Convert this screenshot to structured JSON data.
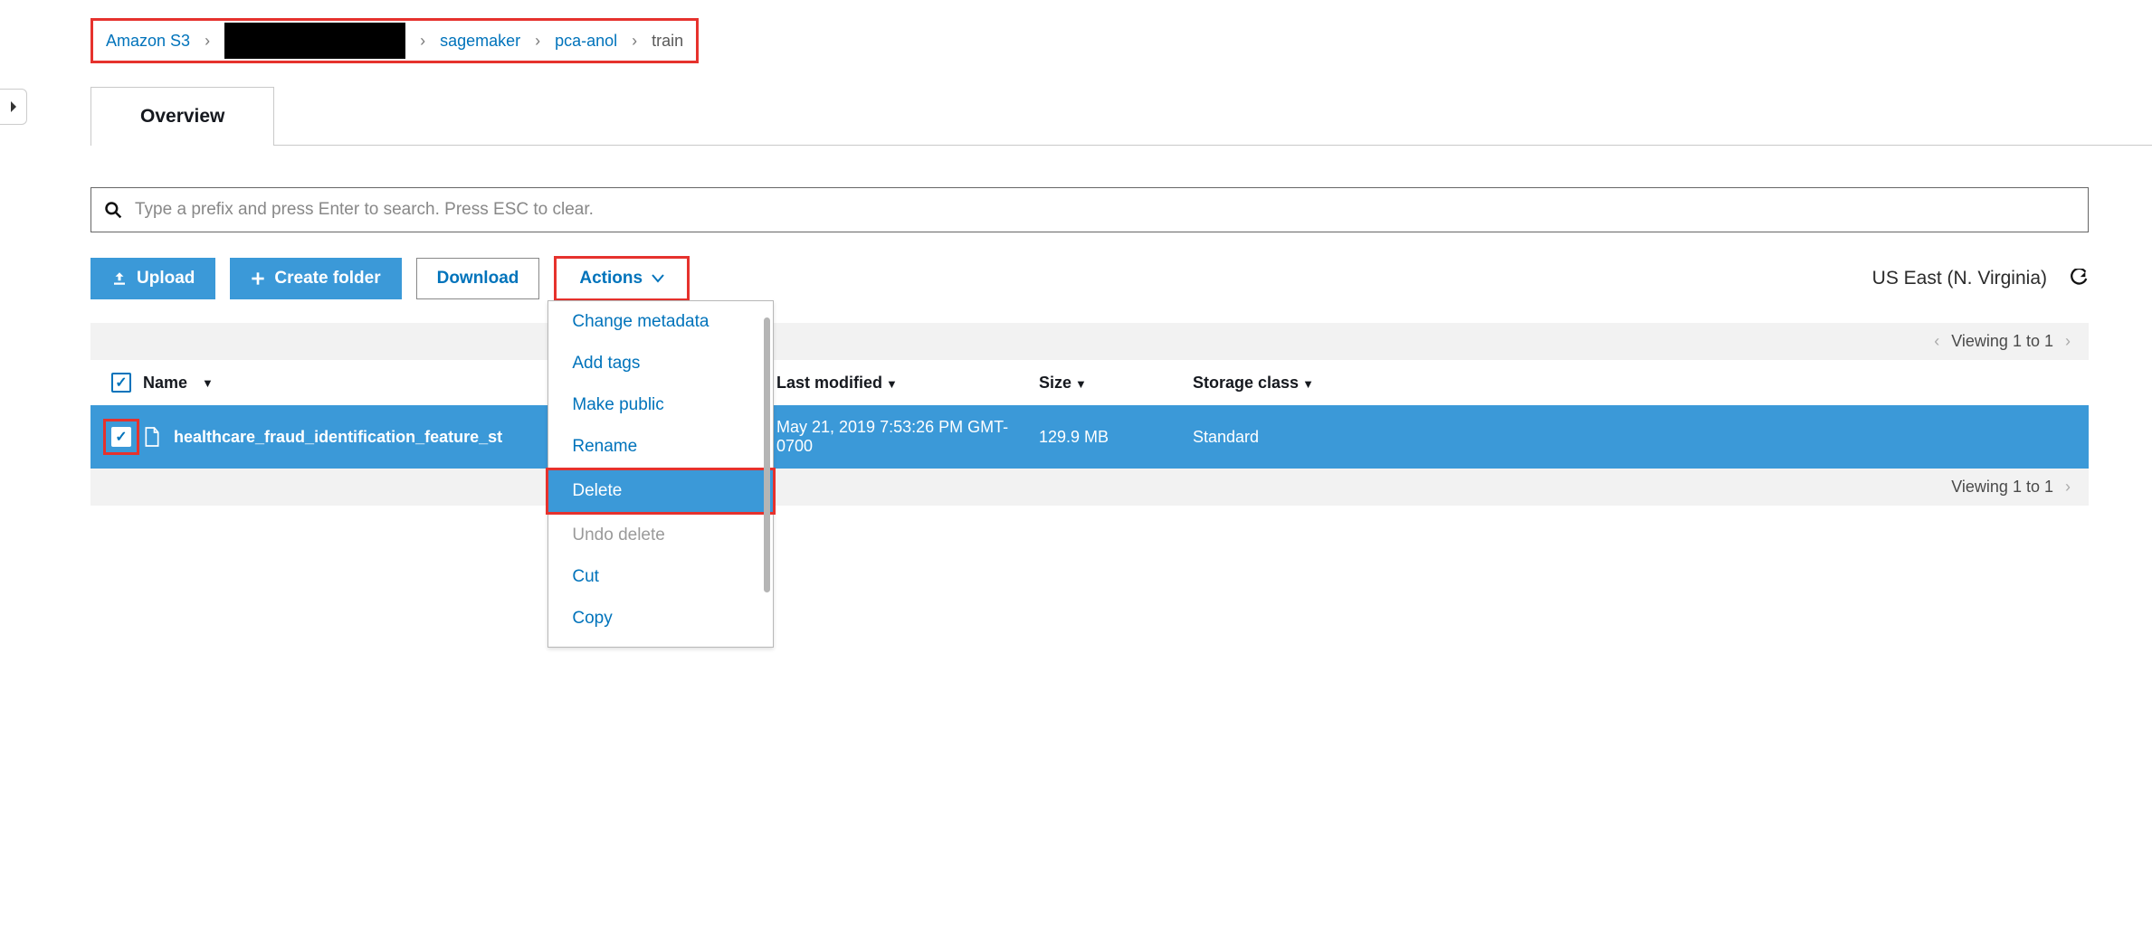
{
  "breadcrumb": {
    "root": "Amazon S3",
    "items": [
      "sagemaker",
      "pca-anol",
      "train"
    ]
  },
  "tab": {
    "overview": "Overview"
  },
  "search": {
    "placeholder": "Type a prefix and press Enter to search. Press ESC to clear."
  },
  "toolbar": {
    "upload": "Upload",
    "create_folder": "Create folder",
    "download": "Download",
    "actions": "Actions",
    "region": "US East (N. Virginia)"
  },
  "actions_menu": {
    "change_metadata": "Change metadata",
    "add_tags": "Add tags",
    "make_public": "Make public",
    "rename": "Rename",
    "delete": "Delete",
    "undo_delete": "Undo delete",
    "cut": "Cut",
    "copy": "Copy"
  },
  "table": {
    "viewing": "Viewing 1 to 1",
    "headers": {
      "name": "Name",
      "last_modified": "Last modified",
      "size": "Size",
      "storage_class": "Storage class"
    },
    "rows": [
      {
        "name": "healthcare_fraud_identification_feature_st",
        "last_modified": "May 21, 2019 7:53:26 PM GMT-0700",
        "size": "129.9 MB",
        "storage_class": "Standard"
      }
    ]
  }
}
